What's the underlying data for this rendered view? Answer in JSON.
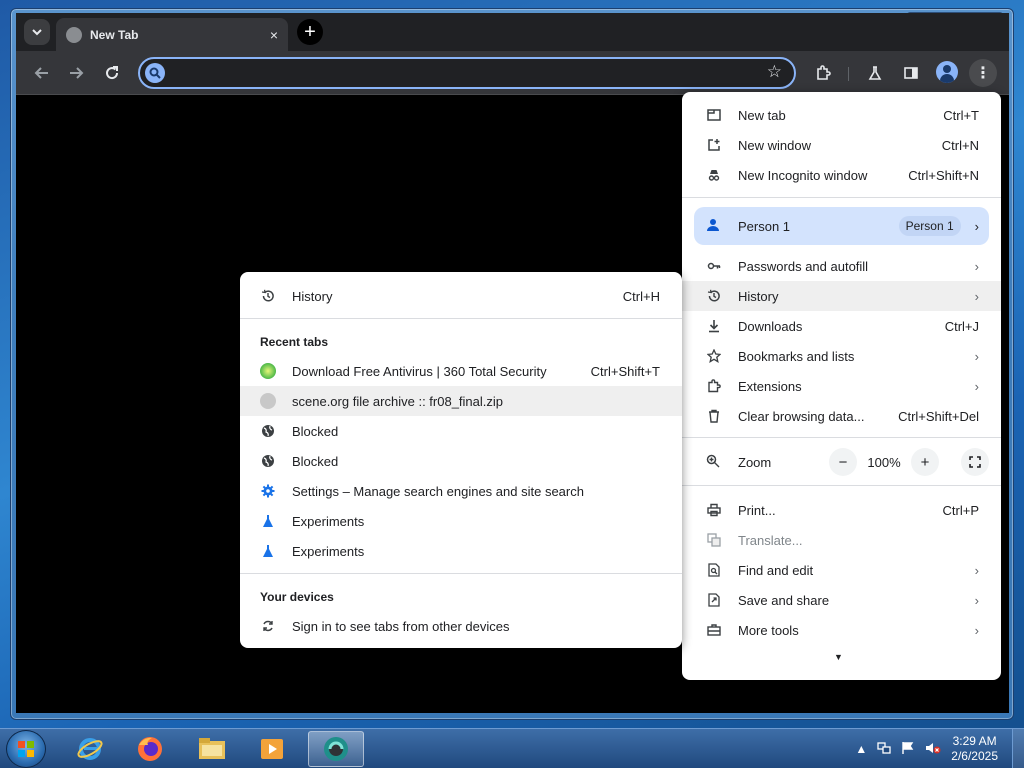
{
  "browser": {
    "tab": {
      "title": "New Tab",
      "close": "×"
    },
    "new_tab_symbol": "+",
    "omnibox": {
      "value": "",
      "placeholder": ""
    }
  },
  "main_menu": {
    "items_top": [
      {
        "icon": "new-tab-icon",
        "label": "New tab",
        "shortcut": "Ctrl+T"
      },
      {
        "icon": "new-window-icon",
        "label": "New window",
        "shortcut": "Ctrl+N"
      },
      {
        "icon": "incognito-icon",
        "label": "New Incognito window",
        "shortcut": "Ctrl+Shift+N"
      }
    ],
    "person": {
      "label": "Person 1",
      "badge": "Person 1"
    },
    "items_mid": [
      {
        "icon": "key-icon",
        "label": "Passwords and autofill",
        "shortcut": "",
        "submenu": true
      },
      {
        "icon": "history-icon",
        "label": "History",
        "shortcut": "",
        "submenu": true
      },
      {
        "icon": "download-icon",
        "label": "Downloads",
        "shortcut": "Ctrl+J",
        "submenu": false
      },
      {
        "icon": "star-icon",
        "label": "Bookmarks and lists",
        "shortcut": "",
        "submenu": true
      },
      {
        "icon": "extensions-icon",
        "label": "Extensions",
        "shortcut": "",
        "submenu": true
      },
      {
        "icon": "trash-icon",
        "label": "Clear browsing data...",
        "shortcut": "Ctrl+Shift+Del",
        "submenu": false
      }
    ],
    "zoom": {
      "label": "Zoom",
      "minus": "−",
      "value": "100%",
      "plus": "+"
    },
    "items_bottom": [
      {
        "icon": "print-icon",
        "label": "Print...",
        "shortcut": "Ctrl+P",
        "submenu": false
      },
      {
        "icon": "translate-icon",
        "label": "Translate...",
        "shortcut": "",
        "submenu": false
      },
      {
        "icon": "find-icon",
        "label": "Find and edit",
        "shortcut": "",
        "submenu": true
      },
      {
        "icon": "share-icon",
        "label": "Save and share",
        "shortcut": "",
        "submenu": true
      },
      {
        "icon": "toolbox-icon",
        "label": "More tools",
        "shortcut": "",
        "submenu": true
      }
    ]
  },
  "history_menu": {
    "history": {
      "label": "History",
      "shortcut": "Ctrl+H"
    },
    "recent_heading": "Recent tabs",
    "recent": [
      {
        "icon": "360-security-icon",
        "label": "Download Free Antivirus | 360 Total Security",
        "shortcut": "Ctrl+Shift+T"
      },
      {
        "icon": "globe-gray-icon",
        "label": "scene.org file archive :: fr08_final.zip",
        "shortcut": ""
      },
      {
        "icon": "globe-icon",
        "label": "Blocked",
        "shortcut": ""
      },
      {
        "icon": "globe-icon",
        "label": "Blocked",
        "shortcut": ""
      },
      {
        "icon": "settings-gear-icon",
        "label": "Settings – Manage search engines and site search",
        "shortcut": ""
      },
      {
        "icon": "flask-icon",
        "label": "Experiments",
        "shortcut": ""
      },
      {
        "icon": "flask-icon",
        "label": "Experiments",
        "shortcut": ""
      }
    ],
    "devices_heading": "Your devices",
    "devices_item": "Sign in to see tabs from other devices"
  },
  "taskbar": {
    "clock_time": "3:29 AM",
    "clock_date": "2/6/2025"
  }
}
